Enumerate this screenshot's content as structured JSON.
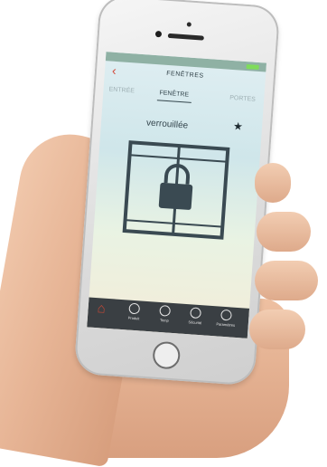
{
  "screen": {
    "nav_title": "FENÊTRES",
    "tabs": [
      "ENTRÉE",
      "FENÊTRE",
      "PORTES"
    ],
    "active_tab": "FENÊTRE",
    "status": "verrouillée",
    "tabbar": [
      {
        "label": "",
        "icon": "lock-icon"
      },
      {
        "label": "Produit",
        "icon": "window-icon"
      },
      {
        "label": "Temp",
        "icon": "clock-icon"
      },
      {
        "label": "Sécurité",
        "icon": "shield-icon"
      },
      {
        "label": "Paramètres",
        "icon": "settings-icon"
      }
    ]
  },
  "colors": {
    "accent": "#d24a3b",
    "tabbar": "#3a3f43"
  }
}
